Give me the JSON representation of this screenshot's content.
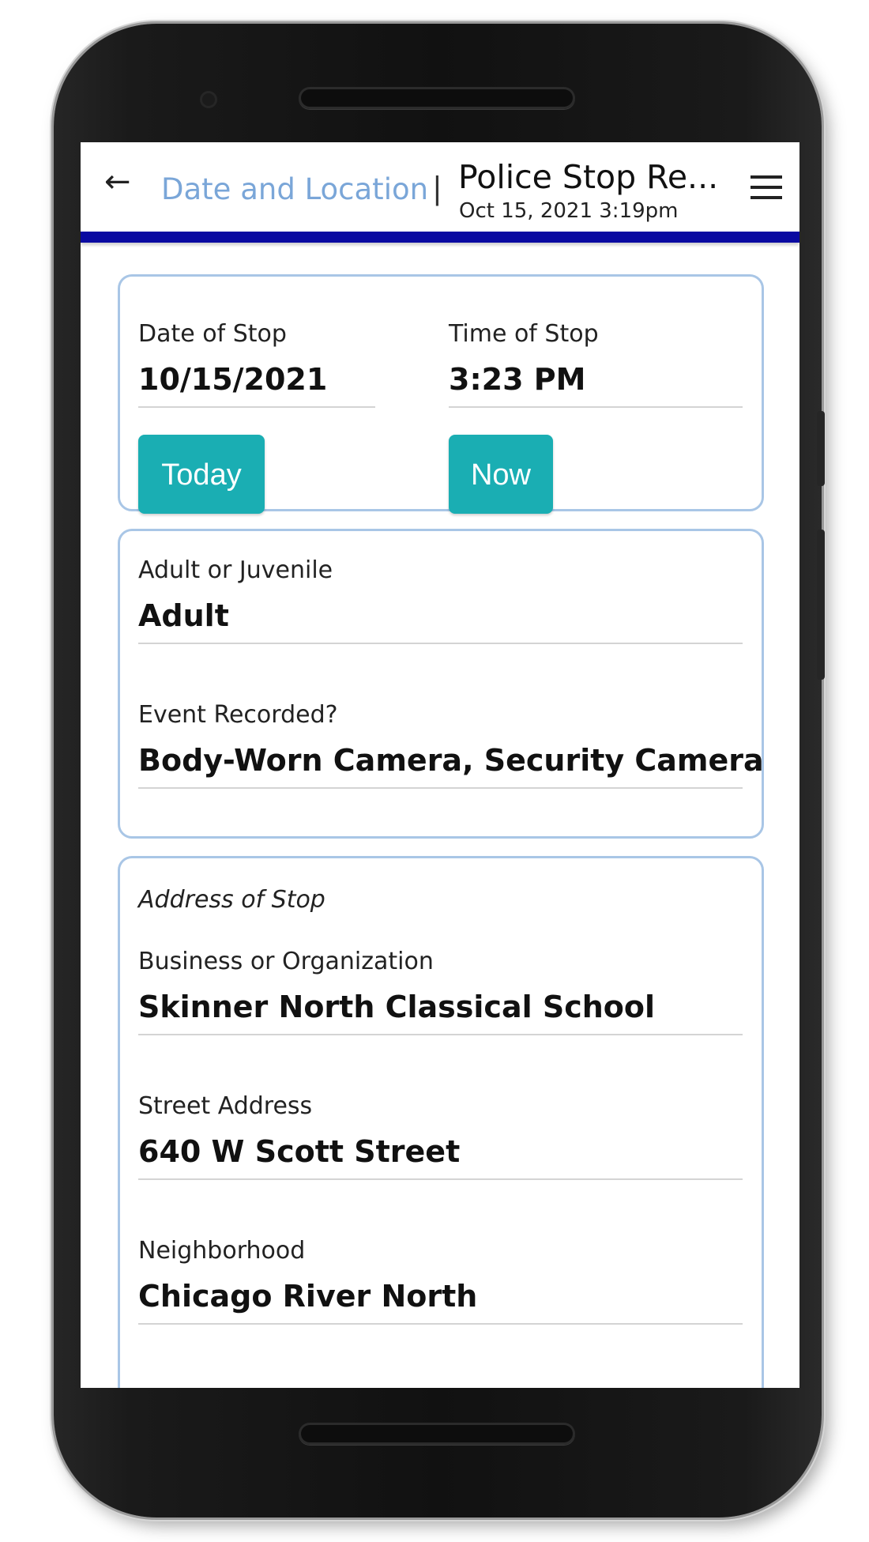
{
  "header": {
    "back_icon": "left-arrow-icon",
    "breadcrumb": "Date and Location",
    "separator": "|",
    "title": "Police Stop Re...",
    "subtitle": "Oct 15, 2021 3:19pm",
    "menu_icon": "hamburger-menu-icon",
    "accent_color": "#0a0aa1"
  },
  "date_time_card": {
    "date_label": "Date of Stop",
    "date_value": "10/15/2021",
    "time_label": "Time of Stop",
    "time_value": "3:23 PM",
    "today_button": "Today",
    "now_button": "Now",
    "button_color": "#1aaeb3"
  },
  "subject_card": {
    "age_label": "Adult or Juvenile",
    "age_value": "Adult",
    "recorded_label": "Event Recorded?",
    "recorded_value": "Body-Worn Camera, Security Camera"
  },
  "address_card": {
    "section_title": "Address of Stop",
    "business_label": "Business or Organization",
    "business_value": "Skinner North Classical School",
    "street_label": "Street Address",
    "street_value": "640 W Scott Street",
    "neighborhood_label": "Neighborhood",
    "neighborhood_value": "Chicago River North"
  }
}
